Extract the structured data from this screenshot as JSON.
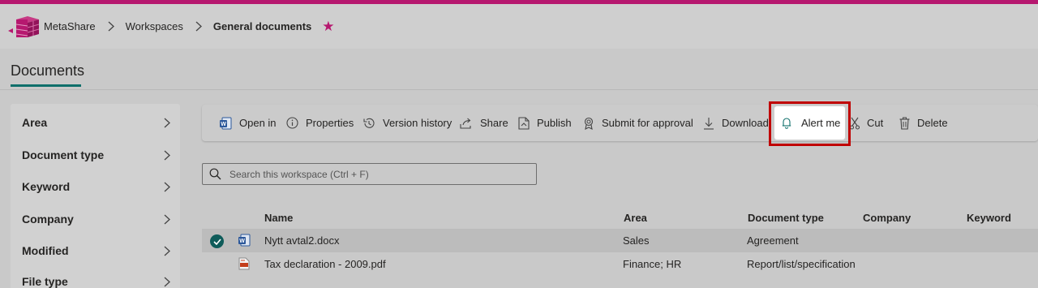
{
  "breadcrumb": {
    "items": [
      "MetaShare",
      "Workspaces",
      "General documents"
    ]
  },
  "page": {
    "title": "Documents"
  },
  "filters": {
    "items": [
      "Area",
      "Document type",
      "Keyword",
      "Company",
      "Modified",
      "File type"
    ]
  },
  "toolbar": {
    "open_in": "Open in",
    "properties": "Properties",
    "version_history": "Version history",
    "share": "Share",
    "publish": "Publish",
    "submit_for_approval": "Submit for approval",
    "download": "Download",
    "alert_me": "Alert me",
    "cut": "Cut",
    "delete": "Delete"
  },
  "search": {
    "placeholder": "Search this workspace (Ctrl + F)"
  },
  "table": {
    "columns": [
      "Name",
      "Area",
      "Document type",
      "Company",
      "Keyword"
    ],
    "rows": [
      {
        "name": "Nytt avtal2.docx",
        "area": "Sales",
        "doctype": "Agreement",
        "company": "",
        "keyword": "",
        "file_icon": "word-icon",
        "selected": true
      },
      {
        "name": "Tax declaration - 2009.pdf",
        "area": "Finance; HR",
        "doctype": "Report/list/specification",
        "company": "",
        "keyword": "",
        "file_icon": "pdf-icon",
        "selected": false
      }
    ]
  },
  "colors": {
    "brand": "#b6186f",
    "accent": "#0f6f6b",
    "highlight": "#c00000"
  }
}
